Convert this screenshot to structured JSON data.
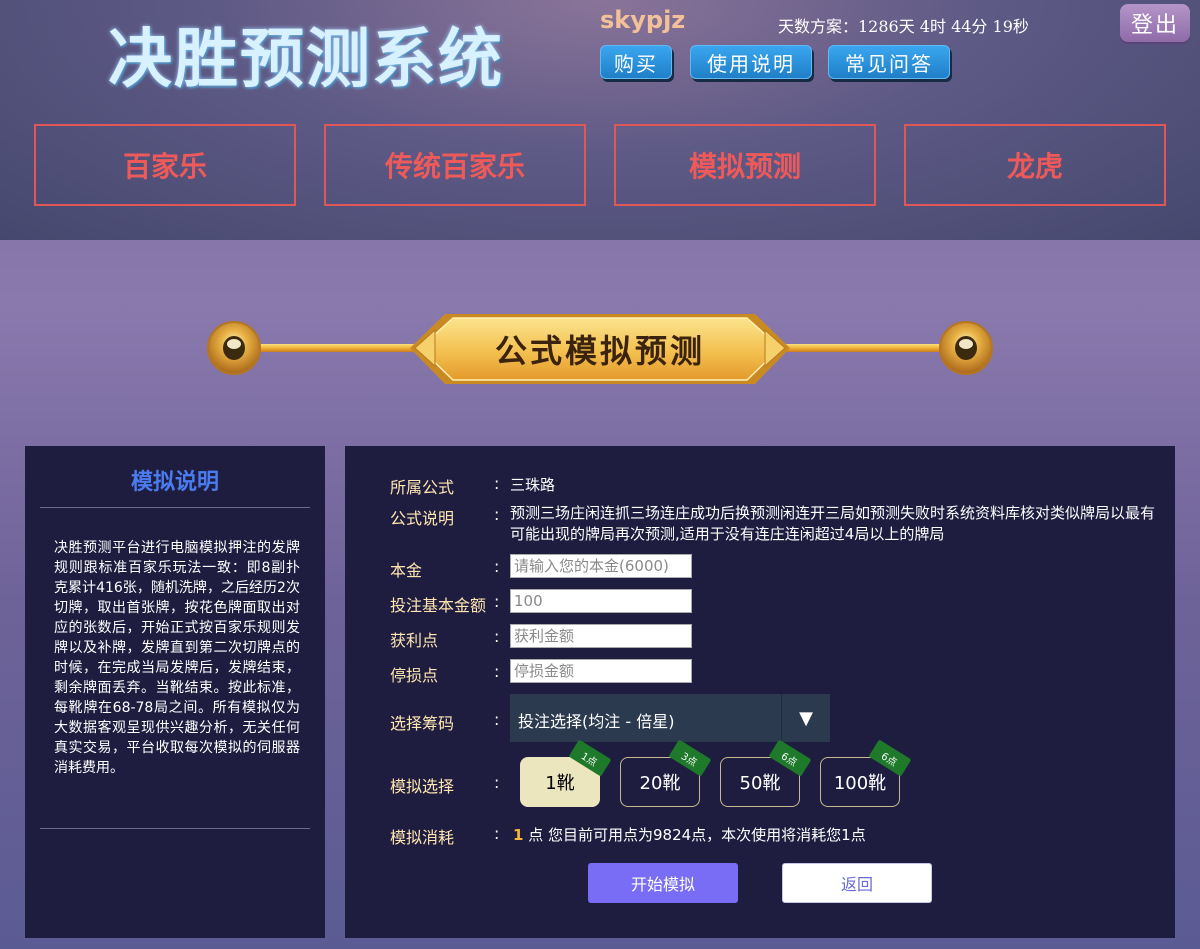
{
  "header": {
    "logo": "决胜预测系统",
    "username": "skypjz",
    "countdown": "天数方案：1286天 4时 44分 19秒",
    "logout": "登出",
    "buttons": {
      "buy": "购买",
      "guide": "使用说明",
      "faq": "常见问答"
    }
  },
  "nav": [
    "百家乐",
    "传统百家乐",
    "模拟预测",
    "龙虎"
  ],
  "banner": {
    "title": "公式模拟预测"
  },
  "left_panel": {
    "title": "模拟说明",
    "text": "决胜预测平台进行电脑模拟押注的发牌规则跟标准百家乐玩法一致：即8副扑克累计416张，随机洗牌，之后经历2次切牌，取出首张牌，按花色牌面取出对应的张数后，开始正式按百家乐规则发牌以及补牌，发牌直到第二次切牌点的时候，在完成当局发牌后，发牌结束，剩余牌面丢弃。当靴结束。按此标准，每靴牌在68-78局之间。所有模拟仅为大数据客观呈现供兴趣分析，无关任何真实交易，平台收取每次模拟的伺服器消耗费用。"
  },
  "form": {
    "colon": ":",
    "formula_label": "所属公式",
    "formula_value": "三珠路",
    "desc_label": "公式说明",
    "desc_value": "预测三场庄闲连抓三场连庄成功后换预测闲连开三局如预测失败时系统资料库核对类似牌局以最有可能出现的牌局再次预测,适用于没有连庄连闲超过4局以上的牌局",
    "principal_label": "本金",
    "principal_placeholder": "请输入您的本金(6000)",
    "base_bet_label": "投注基本金额",
    "base_bet_value": "100",
    "profit_label": "获利点",
    "profit_placeholder": "获利金额",
    "stoploss_label": "停损点",
    "stoploss_placeholder": "停损金额",
    "chips_label": "选择筹码",
    "chips_selected": "投注选择(均注 - 倍星)",
    "sim_label": "模拟选择",
    "shoes": [
      {
        "label": "1靴",
        "cost": "1点",
        "active": true
      },
      {
        "label": "20靴",
        "cost": "3点",
        "active": false
      },
      {
        "label": "50靴",
        "cost": "6点",
        "active": false
      },
      {
        "label": "100靴",
        "cost": "6点",
        "active": false
      }
    ],
    "cost_label": "模拟消耗",
    "cost_value": "1",
    "cost_text": "点 您目前可用点为9824点，本次使用将消耗您1点",
    "start_button": "开始模拟",
    "back_button": "返回"
  }
}
